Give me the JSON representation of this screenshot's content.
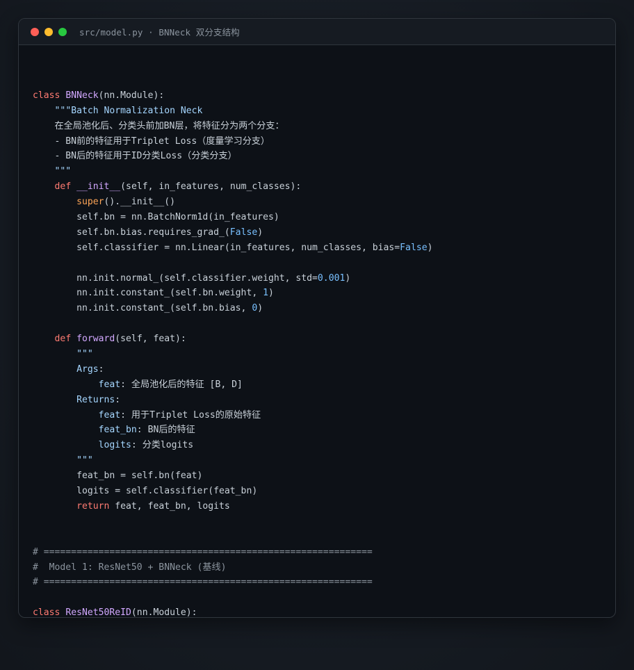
{
  "window": {
    "title": "src/model.py · BNNeck 双分支结构"
  },
  "code": {
    "lines": [
      "",
      "class BNNeck(nn.Module):",
      "    \"\"\"Batch Normalization Neck",
      "    在全局池化后、分类头前加BN层，将特征分为两个分支：",
      "    - BN前的特征用于Triplet Loss（度量学习分支）",
      "    - BN后的特征用于ID分类Loss（分类分支）",
      "    \"\"\"",
      "    def __init__(self, in_features, num_classes):",
      "        super().__init__()",
      "        self.bn = nn.BatchNorm1d(in_features)",
      "        self.bn.bias.requires_grad_(False)",
      "        self.classifier = nn.Linear(in_features, num_classes, bias=False)",
      "",
      "        nn.init.normal_(self.classifier.weight, std=0.001)",
      "        nn.init.constant_(self.bn.weight, 1)",
      "        nn.init.constant_(self.bn.bias, 0)",
      "",
      "    def forward(self, feat):",
      "        \"\"\"",
      "        Args:",
      "            feat: 全局池化后的特征 [B, D]",
      "        Returns:",
      "            feat: 用于Triplet Loss的原始特征",
      "            feat_bn: BN后的特征",
      "            logits: 分类logits",
      "        \"\"\"",
      "        feat_bn = self.bn(feat)",
      "        logits = self.classifier(feat_bn)",
      "        return feat, feat_bn, logits",
      "",
      "",
      "# ============================================================",
      "#  Model 1: ResNet50 + BNNeck (基线)",
      "# ============================================================",
      "",
      "class ResNet50ReID(nn.Module):"
    ]
  },
  "colors": {
    "keyword": "#ff7b72",
    "class_name": "#d2a8ff",
    "builtin": "#ffa657",
    "string": "#a5d6ff",
    "number": "#79c0ff",
    "comment": "#8b949e",
    "text": "#c9d1d9",
    "background": "#0d1117"
  }
}
